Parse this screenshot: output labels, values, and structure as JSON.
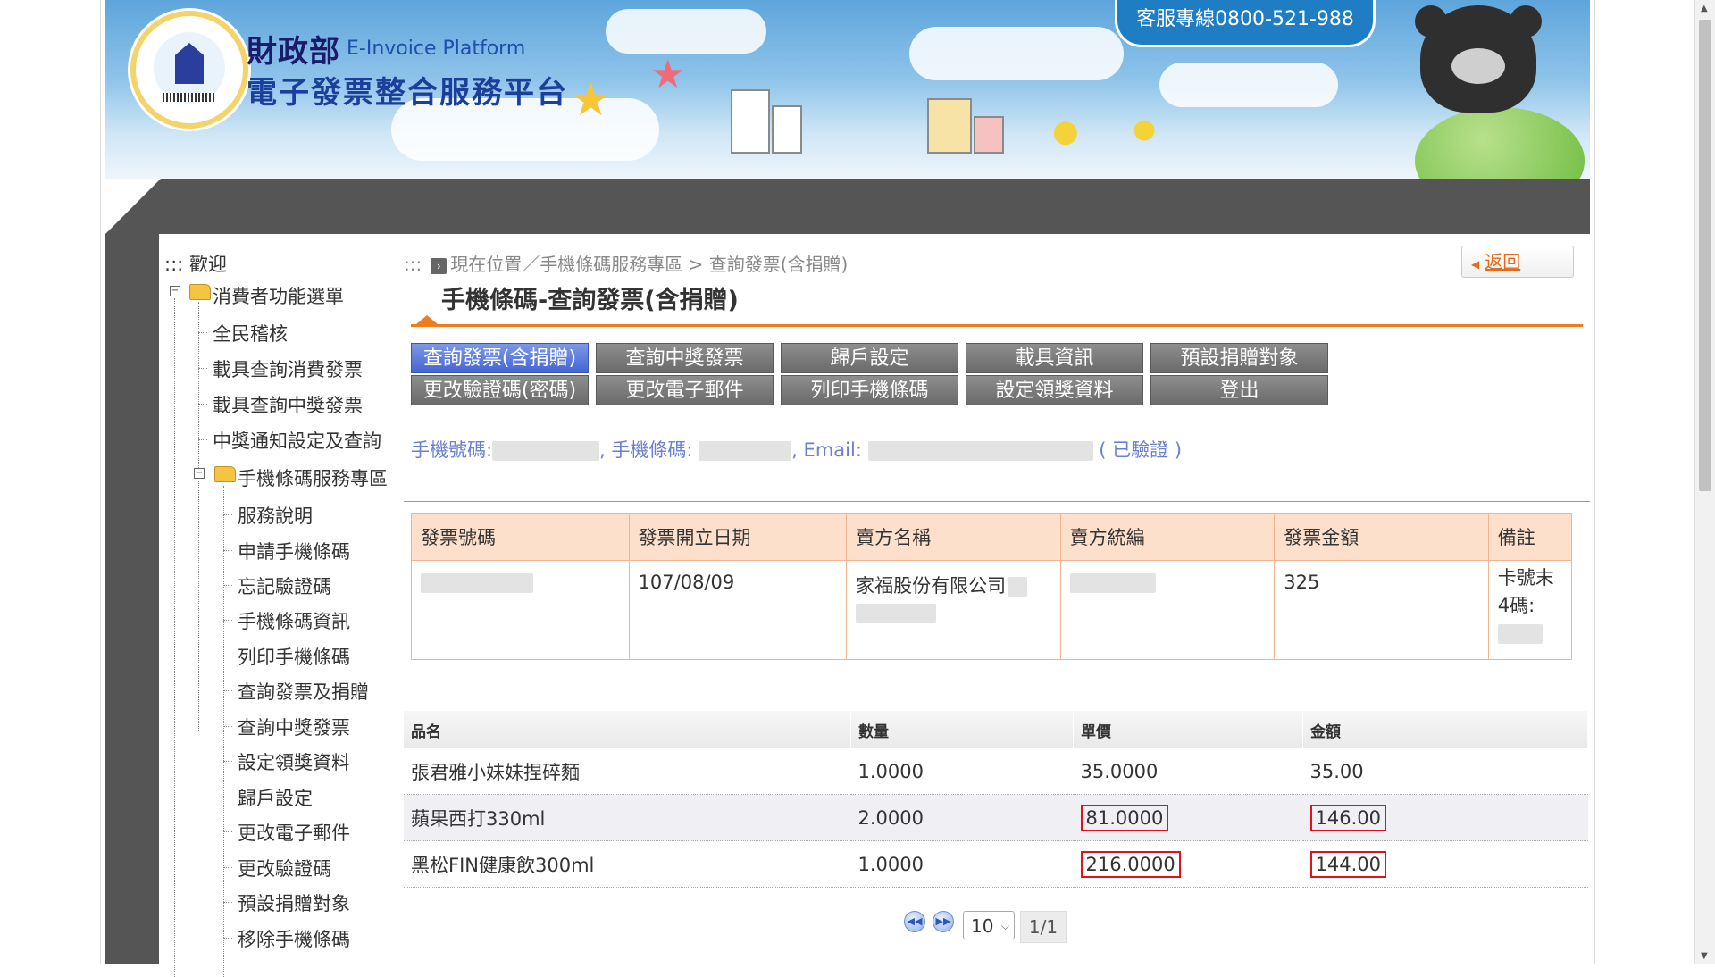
{
  "header": {
    "brand_cn": "財政部",
    "brand_en": "E-Invoice Platform",
    "brand_title": "電子發票整合服務平台",
    "hotline": "客服專線0800-521-988"
  },
  "sidebar": {
    "welcome": "::: 歡迎",
    "consumer_menu": "消費者功能選單",
    "items_level1": [
      "全民稽核",
      "載具查詢消費發票",
      "載具查詢中獎發票",
      "中獎通知設定及查詢"
    ],
    "mobile_section": "手機條碼服務專區",
    "items_level2": [
      "服務說明",
      "申請手機條碼",
      "忘記驗證碼",
      "手機條碼資訊",
      "列印手機條碼",
      "查詢發票及捐贈",
      "查詢中獎發票",
      "設定領獎資料",
      "歸戶設定",
      "更改電子郵件",
      "更改驗證碼",
      "預設捐贈對象",
      "移除手機條碼"
    ]
  },
  "breadcrumb": {
    "prefix": ":::",
    "text": "現在位置／手機條碼服務專區 > 查詢發票(含捐贈)"
  },
  "back_button": "返回",
  "page_title": "手機條碼-查詢發票(含捐贈)",
  "nav": {
    "row1": [
      "查詢發票(含捐贈)",
      "查詢中獎發票",
      "歸戶設定",
      "載具資訊",
      "預設捐贈對象"
    ],
    "row2": [
      "更改驗證碼(密碼)",
      "更改電子郵件",
      "列印手機條碼",
      "設定領獎資料",
      "登出"
    ]
  },
  "user_info": {
    "phone_label": "手機號碼:",
    "barcode_label": ", 手機條碼:",
    "email_label": ", Email:",
    "verified": "( 已驗證 )"
  },
  "invoice": {
    "headers": [
      "發票號碼",
      "發票開立日期",
      "賣方名稱",
      "賣方統編",
      "發票金額",
      "備註"
    ],
    "date": "107/08/09",
    "seller_name": "家福股份有限公司",
    "amount": "325",
    "remark": "卡號末4碼:"
  },
  "items": {
    "headers": [
      "品名",
      "數量",
      "單價",
      "金額"
    ],
    "rows": [
      {
        "name": "張君雅小妹妹捏碎麵",
        "qty": "1.0000",
        "price": "35.0000",
        "amount": "35.00"
      },
      {
        "name": "蘋果西打330ml",
        "qty": "2.0000",
        "price": "81.0000",
        "amount": "146.00"
      },
      {
        "name": "黑松FIN健康飲300ml",
        "qty": "1.0000",
        "price": "216.0000",
        "amount": "144.00"
      }
    ]
  },
  "pager": {
    "page_size": "10",
    "page_count": "1/1"
  },
  "colors": {
    "accent_orange": "#f07d1c",
    "nav_active": "#4466d3",
    "highlight_red": "#e0121c"
  }
}
